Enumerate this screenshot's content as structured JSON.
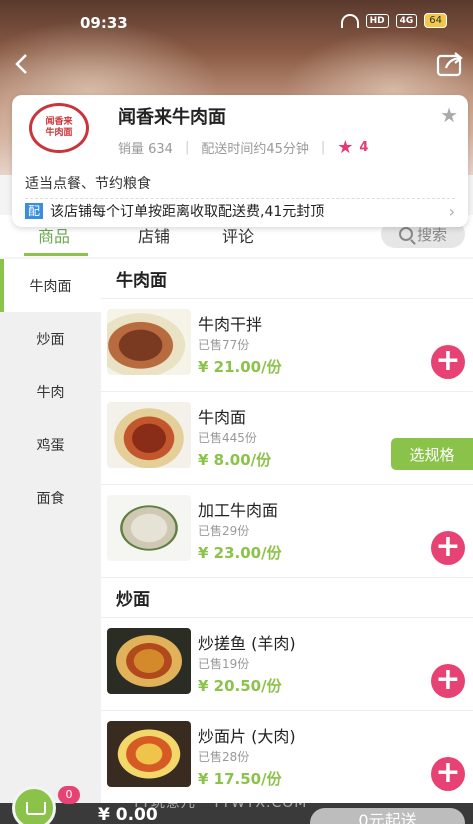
{
  "status_bar": {
    "time": "09:33",
    "hd_label": "HD",
    "network_label": "4G",
    "battery": "64"
  },
  "header": {
    "back_icon": "chevron-left-icon",
    "share_icon": "share-icon"
  },
  "store": {
    "logo_text": [
      "闻香来",
      "牛肉面"
    ],
    "name": "闻香来牛肉面",
    "sales_label": "销量 634",
    "delivery_time": "配送时间约45分钟",
    "rating": "4",
    "description": "适当点餐、节约粮食",
    "notice_tag": "配",
    "notice_text": "该店铺每个订单按距离收取配送费,41元封顶",
    "accent_color": "#e73a72"
  },
  "tabs": {
    "items": [
      {
        "label": "商品"
      },
      {
        "label": "店铺"
      },
      {
        "label": "评论"
      }
    ],
    "active_index": 0,
    "search_label": "搜索",
    "accent_color": "#8bc34a"
  },
  "categories": [
    {
      "label": "牛肉面",
      "active": true
    },
    {
      "label": "炒面"
    },
    {
      "label": "牛肉"
    },
    {
      "label": "鸡蛋"
    },
    {
      "label": "面食"
    }
  ],
  "sections": [
    {
      "title": "牛肉面",
      "items": [
        {
          "name": "牛肉干拌",
          "sold": "已售77份",
          "price": "¥ 21.00/份",
          "action": "add"
        },
        {
          "name": "牛肉面",
          "sold": "已售445份",
          "price": "¥ 8.00/份",
          "action": "spec",
          "spec_label": "选规格"
        },
        {
          "name": "加工牛肉面",
          "sold": "已售29份",
          "price": "¥ 23.00/份",
          "action": "add"
        }
      ]
    },
    {
      "title": "炒面",
      "items": [
        {
          "name": "炒搓鱼 (羊肉)",
          "sold": "已售19份",
          "price": "¥ 20.50/份",
          "action": "add"
        },
        {
          "name": "炒面片 (大肉)",
          "sold": "已售28份",
          "price": "¥ 17.50/份",
          "action": "add"
        }
      ]
    }
  ],
  "cart": {
    "count": "0",
    "total": "¥ 0.00",
    "checkout_label": "0元起送"
  },
  "watermark": "TT玩意儿 · TTWYX.COM"
}
